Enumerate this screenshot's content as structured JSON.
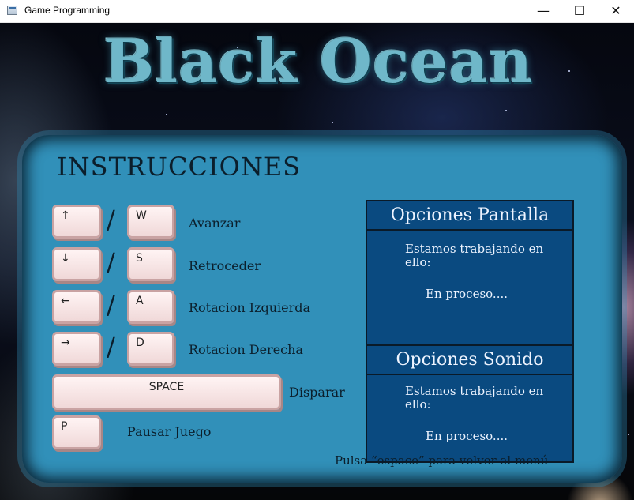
{
  "window": {
    "title": "Game Programming",
    "minimize": "—",
    "maximize": "☐",
    "close": "✕"
  },
  "game": {
    "logo": "Black Ocean",
    "heading": "INSTRUCCIONES",
    "controls": [
      {
        "key": "↑",
        "alt_key": "W",
        "action": "Avanzar"
      },
      {
        "key": "↓",
        "alt_key": "S",
        "action": "Retroceder"
      },
      {
        "key": "←",
        "alt_key": "A",
        "action": "Rotacion Izquierda"
      },
      {
        "key": "→",
        "alt_key": "D",
        "action": "Rotacion Derecha"
      }
    ],
    "slash": "/",
    "space": {
      "key": "SPACE",
      "action": "Disparar"
    },
    "pause": {
      "key": "P",
      "action": "Pausar Juego"
    },
    "options": {
      "screen_title": "Opciones Pantalla",
      "screen_text": "Estamos trabajando en ello:",
      "screen_status": "En proceso....",
      "sound_title": "Opciones Sonido",
      "sound_text": "Estamos trabajando en ello:",
      "sound_status": "En proceso...."
    },
    "footer": "Pulsa “espace” para volver al menú"
  },
  "colors": {
    "panel": "#3190b9",
    "options_bg": "#0a4a80",
    "logo": "#6fb7c9"
  }
}
